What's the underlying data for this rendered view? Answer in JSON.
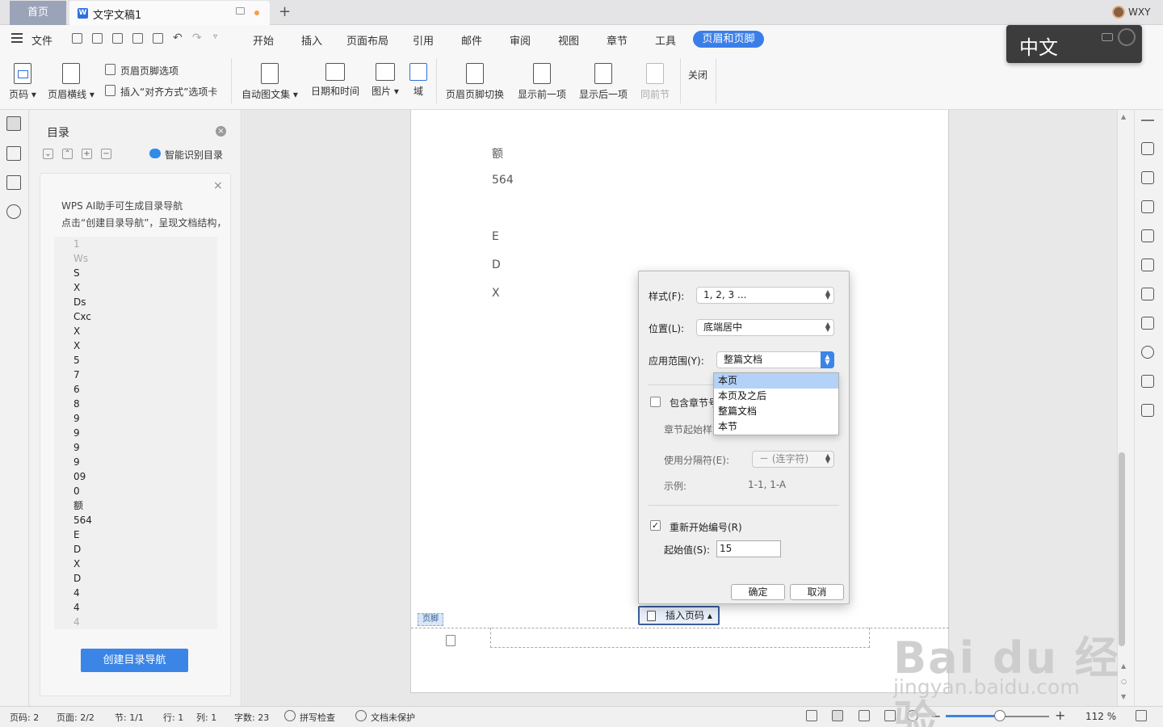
{
  "tabs": {
    "home": "首页",
    "document": "文字文稿1",
    "add": "+"
  },
  "user": {
    "name": "WXY"
  },
  "menu": {
    "file": "文件",
    "items": [
      "开始",
      "插入",
      "页面布局",
      "引用",
      "邮件",
      "审阅",
      "视图",
      "章节",
      "工具"
    ],
    "active": "页眉和页脚"
  },
  "ime": {
    "label": "中文"
  },
  "ribbon": {
    "page_number": "页码",
    "header_line": "页眉横线",
    "hf_options": "页眉页脚选项",
    "insert_align_tab": "插入“对齐方式”选项卡",
    "auto_text": "自动图文集",
    "date_time": "日期和时间",
    "picture": "图片",
    "field": "域",
    "hf_switch": "页眉页脚切换",
    "show_prev": "显示前一项",
    "show_next": "显示后一项",
    "same_as_prev": "同前节",
    "close": "关闭"
  },
  "toc": {
    "title": "目录",
    "smart": "智能识别目录",
    "card_line1": "WPS AI助手可生成目录导航",
    "card_line2": "点击“创建目录导航”，呈现文档结构，",
    "items": [
      "1",
      "Ws",
      "S",
      "X",
      "Ds",
      "Cxc",
      "X",
      "X",
      "5",
      "7",
      "6",
      "8",
      "9",
      "9",
      "9",
      "9",
      "09",
      "0",
      "额",
      "564",
      "E",
      "D",
      "X",
      "D",
      "4",
      "4",
      "4"
    ],
    "create_button": "创建目录导航"
  },
  "document": {
    "lines": [
      "额",
      "564",
      "E",
      "D",
      "X"
    ],
    "footer_tag": "页脚",
    "insert_page_number": "插入页码"
  },
  "dialog": {
    "style_label": "样式(F):",
    "style_value": "1, 2, 3 ...",
    "position_label": "位置(L):",
    "position_value": "底端居中",
    "scope_label": "应用范围(Y):",
    "scope_value": "整篇文档",
    "scope_options": [
      "本页",
      "本页及之后",
      "整篇文档",
      "本节"
    ],
    "include_chapter": "包含章节号",
    "chapter_start": "章节起始样式:",
    "separator_label": "使用分隔符(E):",
    "separator_value": "－  (连字符)",
    "example_label": "示例:",
    "example_value": "1-1, 1-A",
    "restart_label": "重新开始编号(R)",
    "restart_checked": true,
    "start_label": "起始值(S):",
    "start_value": "15",
    "ok": "确定",
    "cancel": "取消"
  },
  "status": {
    "page_num": "页码: 2",
    "pages": "页面: 2/2",
    "section": "节: 1/1",
    "row": "行: 1",
    "col": "列: 1",
    "words": "字数: 23",
    "spell": "拼写检查",
    "protect": "文档未保护",
    "zoom": "112 %",
    "zoom_fraction": 0.52
  },
  "watermark": {
    "logo": "Bai du 经验",
    "url": "jingyan.baidu.com"
  },
  "colors": {
    "accent": "#3a85e6",
    "tab_home": "#9aa3b8",
    "dropdown_selected": "#b4d2f7"
  }
}
